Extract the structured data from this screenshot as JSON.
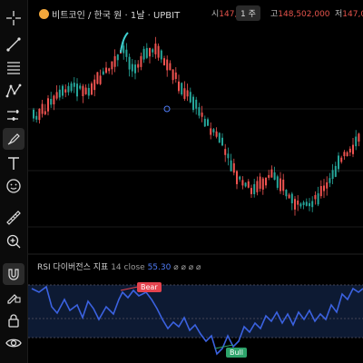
{
  "header": {
    "symbol_title": "비트코인 / 한국 원 · 1날 · UPBIT",
    "open_label": "시",
    "open_value": "147,",
    "high_label": "고",
    "high_value": "148,502,000",
    "low_label": "저",
    "low_value": "147,0",
    "interval_pill": "1 주"
  },
  "indicator": {
    "name": "RSI 다이버전스 지표",
    "params": "14 close",
    "value": "55.30",
    "circles": "⌀ ⌀ ⌀ ⌀"
  },
  "badges": {
    "bear": "Bear",
    "bull": "Bull"
  },
  "toolbar": {
    "items": [
      "crosshair-icon",
      "trend-line-icon",
      "fib-retracement-icon",
      "pattern-icon",
      "projection-icon",
      "brush-icon",
      "text-icon",
      "emoji-icon",
      "ruler-icon",
      "zoom-in-icon",
      "magnet-icon",
      "lock-drawing-icon",
      "lock-icon",
      "eye-icon"
    ]
  },
  "colors": {
    "up": "#26a69a",
    "down": "#ef5350",
    "rsi_line": "#3b62e0",
    "rsi_band": "#0d1a33",
    "bear": "#e5434e",
    "bull": "#2da36b"
  }
}
